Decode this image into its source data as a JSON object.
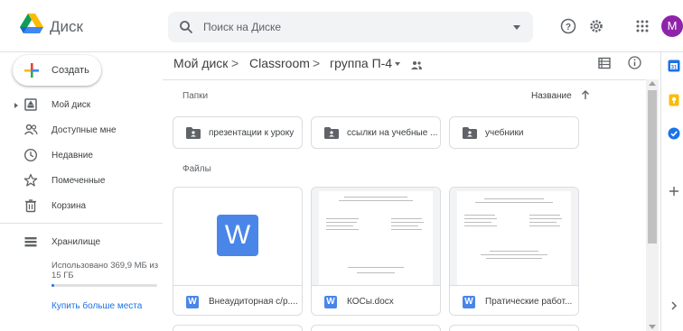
{
  "header": {
    "app_name": "Диск",
    "search_placeholder": "Поиск на Диске",
    "avatar_letter": "M",
    "icons": [
      "drive-logo-icon",
      "search-icon",
      "help-icon",
      "settings-gear-icon",
      "apps-grid-icon"
    ]
  },
  "sidebar": {
    "new_button": "Создать",
    "items": [
      {
        "label": "Мой диск",
        "icon": "my-drive-icon"
      },
      {
        "label": "Доступные мне",
        "icon": "shared-people-icon"
      },
      {
        "label": "Недавние",
        "icon": "clock-icon"
      },
      {
        "label": "Помеченные",
        "icon": "star-icon"
      },
      {
        "label": "Корзина",
        "icon": "trash-icon"
      }
    ],
    "storage": {
      "label": "Хранилище",
      "usage_text": "Использовано 369,9 МБ из 15 ГБ",
      "used_fraction": 0.025,
      "buy_link": "Купить больше места"
    }
  },
  "breadcrumb": {
    "items": [
      "Мой диск",
      "Classroom",
      "группа П-4"
    ],
    "separator": ">"
  },
  "sections": {
    "folders_title": "Папки",
    "files_title": "Файлы",
    "sort_label": "Название"
  },
  "folders": [
    {
      "name": "презентации к уроку"
    },
    {
      "name": "ссылки на учебные ..."
    },
    {
      "name": "учебники"
    }
  ],
  "files": [
    {
      "name": "Внеаудиторная с/р....",
      "type_icon": "W"
    },
    {
      "name": "КОСы.docx",
      "type_icon": "W"
    },
    {
      "name": "Пратические работ...",
      "type_icon": "W"
    }
  ],
  "colors": {
    "accent": "#1a73e8",
    "word_blue": "#4a86e8",
    "avatar": "#8e24aa"
  }
}
